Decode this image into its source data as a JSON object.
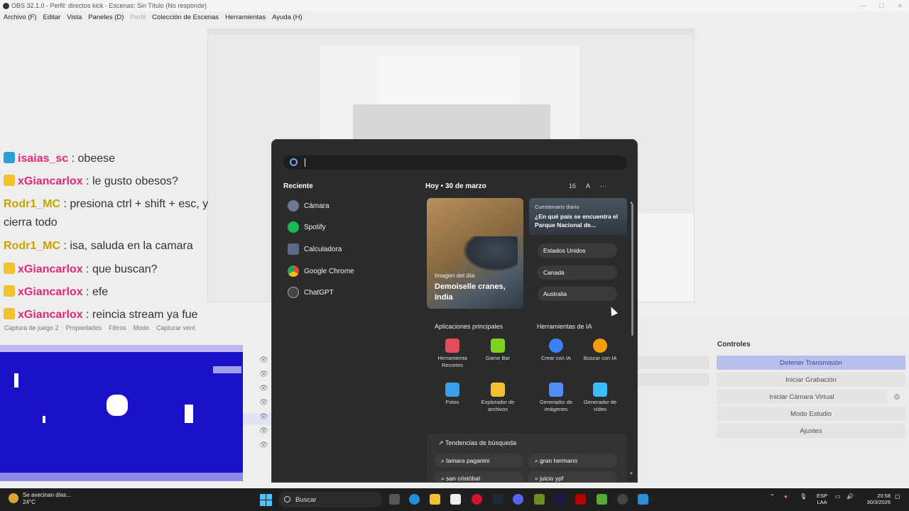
{
  "window": {
    "title": "OBS 32.1.0 - Perfil: directos kick - Escenas: Sin Título (No responde)"
  },
  "menu": [
    "Archivo (F)",
    "Editar",
    "Vista",
    "Paneles (D)",
    "Perfil",
    "Colección de Escenas",
    "Herramientas",
    "Ayuda (H)"
  ],
  "chat": [
    {
      "user": "isaias_sc",
      "msg": " : obeese",
      "color": "pink"
    },
    {
      "user": "xGiancarlox",
      "msg": " : le gusto obesos?",
      "color": "pink"
    },
    {
      "user": "Rodr1_MC",
      "msg": " : presiona ctrl + shift + esc, y",
      "color": "yellow"
    },
    {
      "user": "",
      "msg": "cierra todo",
      "color": "none"
    },
    {
      "user": "Rodr1_MC",
      "msg": " : isa, saluda en la camara",
      "color": "yellow"
    },
    {
      "user": "xGiancarlox",
      "msg": " : que buscan?",
      "color": "pink"
    },
    {
      "user": "xGiancarlox",
      "msg": " : efe",
      "color": "pink"
    },
    {
      "user": "xGiancarlox",
      "msg": " : reincia stream ya fue",
      "color": "pink"
    }
  ],
  "source_toolbar": {
    "source": "Captura de juego 2",
    "properties": "Propiedades",
    "filters": "Filtros",
    "mode": "Modo",
    "capture": "Capturar vent"
  },
  "controls": {
    "title": "Controles",
    "buttons": [
      "Detener Transmisión",
      "Iniciar Grabación",
      "Iniciar Cámara Virtual",
      "Modo Estudio",
      "Ajustes"
    ]
  },
  "start_menu": {
    "recent_title": "Reciente",
    "recent": [
      {
        "label": "Cámara",
        "icon": "camera-icon",
        "color": "#6b7a8c"
      },
      {
        "label": "Spotify",
        "icon": "spotify-icon",
        "color": "#1db954"
      },
      {
        "label": "Calculadora",
        "icon": "calculator-icon",
        "color": "#5a6b8a"
      },
      {
        "label": "Google Chrome",
        "icon": "chrome-icon",
        "color": "#dd4b39"
      },
      {
        "label": "ChatGPT",
        "icon": "chatgpt-icon",
        "color": "#444444"
      }
    ],
    "today": "Hoy  •  30 de marzo",
    "today_tools": {
      "count": "16",
      "font": "A",
      "more": "···"
    },
    "image_card": {
      "label": "Imagen del día",
      "title": "Demoiselle cranes, India"
    },
    "quiz": {
      "label": "Cuestionario diario",
      "question": "¿En qué país se encuentra el Parque Nacional de...",
      "options": [
        "Estados Unidos",
        "Canadá",
        "Australia"
      ]
    },
    "main_apps": {
      "title": "Aplicaciones principales",
      "apps": [
        {
          "label": "Herramienta Recortes",
          "color": "#e04d5c"
        },
        {
          "label": "Game Bar",
          "color": "#7ed321"
        },
        {
          "label": "Fotos",
          "color": "#3aa0e8"
        },
        {
          "label": "Explorador de archivos",
          "color": "#f2c12e"
        }
      ]
    },
    "ai_tools": {
      "title": "Herramientas de IA",
      "apps": [
        {
          "label": "Crear con IA",
          "color": "#3b82f6"
        },
        {
          "label": "Buscar con IA",
          "color": "#f59e0b"
        },
        {
          "label": "Generador de imágenes",
          "color": "#4f8ff7"
        },
        {
          "label": "Generador de vídeo",
          "color": "#38bdf8"
        }
      ]
    },
    "trends": {
      "title": "Tendencias de búsqueda",
      "items": [
        "tamara paganini",
        "gran hermano",
        "san cristóbal",
        "juicio ypf"
      ]
    }
  },
  "taskbar": {
    "weather_line1": "Se avecinan días...",
    "weather_line2": "24°C",
    "search": "Buscar",
    "lang1": "ESP",
    "lang2": "LAA",
    "time": "20:58",
    "date": "30/3/2026"
  }
}
